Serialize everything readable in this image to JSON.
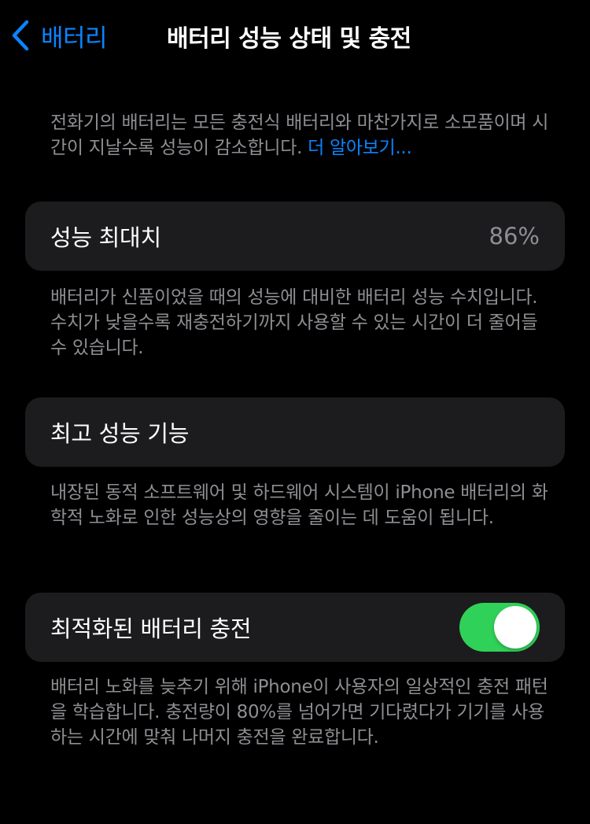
{
  "nav": {
    "back_label": "배터리",
    "title": "배터리 성능 상태 및 충전"
  },
  "intro": {
    "text": "전화기의 배터리는 모든 충전식 배터리와 마찬가지로 소모품이며 시간이 지날수록 성능이 감소합니다.",
    "link": "더 알아보기..."
  },
  "max_capacity": {
    "label": "성능 최대치",
    "value": "86%",
    "description": "배터리가 신품이었을 때의 성능에 대비한 배터리 성능 수치입니다. 수치가 낮을수록 재충전하기까지 사용할 수 있는 시간이 더 줄어들 수 있습니다."
  },
  "peak_performance": {
    "label": "최고 성능 기능",
    "description": "내장된 동적 소프트웨어 및 하드웨어 시스템이 iPhone 배터리의 화학적 노화로 인한 성능상의 영향을 줄이는 데 도움이 됩니다."
  },
  "optimized_charging": {
    "label": "최적화된 배터리 충전",
    "enabled": true,
    "description": "배터리 노화를 늦추기 위해 iPhone이 사용자의 일상적인 충전 패턴을 학습합니다. 충전량이 80%를 넘어가면 기다렸다가 기기를 사용하는 시간에 맞춰 나머지 충전을 완료합니다."
  },
  "colors": {
    "accent": "#0a84ff",
    "toggle_on": "#30d158",
    "cell_background": "#1c1c1e",
    "secondary_text": "#8e8e93"
  }
}
